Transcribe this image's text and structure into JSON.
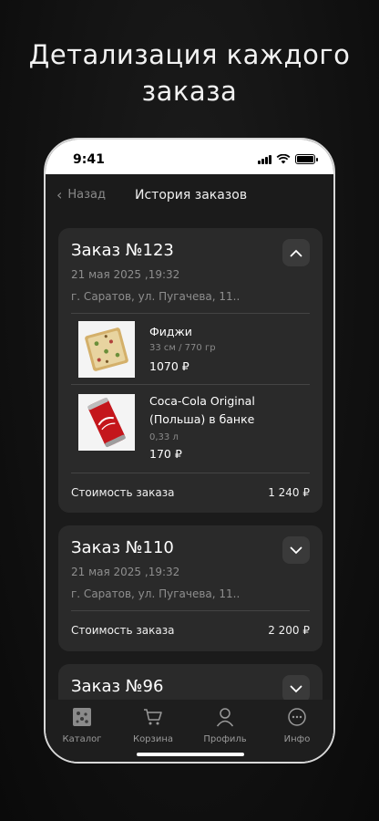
{
  "headline": [
    "Детализация каждого",
    "заказа"
  ],
  "status": {
    "time": "9:41"
  },
  "nav": {
    "back_label": "Назад",
    "title": "История заказов"
  },
  "orders": [
    {
      "title": "Заказ №123",
      "date": "21 мая 2025 ,19:32",
      "address": "г. Саратов, ул. Пугачева, 11..",
      "expanded": true,
      "items": [
        {
          "name": "Фиджи",
          "meta": "33 см / 770 гр",
          "price": "1070 ₽",
          "icon": "pizza-icon"
        },
        {
          "name": "Coca-Cola Original\n(Польша) в банке",
          "name_line1": "Coca-Cola Original",
          "name_line2": "(Польша) в банке",
          "meta": "0,33 л",
          "price": "170 ₽",
          "icon": "cola-can-icon"
        }
      ],
      "total_label": "Стоимость заказа",
      "total": "1 240 ₽"
    },
    {
      "title": "Заказ №110",
      "date": "21 мая 2025 ,19:32",
      "address": "г. Саратов, ул. Пугачева, 11..",
      "expanded": false,
      "total_label": "Стоимость заказа",
      "total": "2 200 ₽"
    },
    {
      "title": "Заказ №96",
      "expanded": false
    }
  ],
  "tabs": [
    {
      "label": "Каталог",
      "icon": "catalog-icon"
    },
    {
      "label": "Корзина",
      "icon": "cart-icon"
    },
    {
      "label": "Профиль",
      "icon": "profile-icon"
    },
    {
      "label": "Инфо",
      "icon": "info-icon"
    }
  ],
  "colors": {
    "background": "#111111",
    "card": "#2a2a2a",
    "muted_text": "#8e8e8e"
  }
}
